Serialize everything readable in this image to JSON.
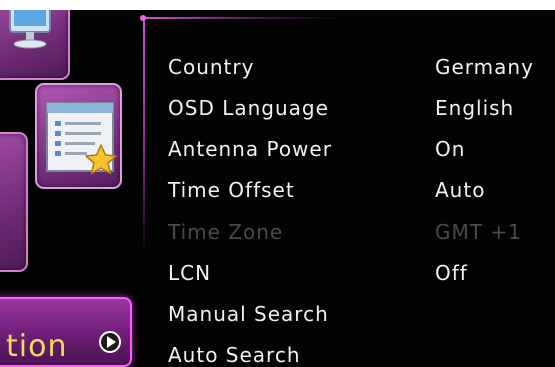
{
  "sidebar": {
    "tiles": [
      {
        "name": "monitor",
        "icon": "monitor-icon"
      },
      {
        "name": "settings",
        "icon": "settings-star-icon"
      },
      {
        "name": "side",
        "icon": ""
      }
    ],
    "active_label": "tion",
    "active_icon": "arrow-right-icon"
  },
  "menu": {
    "items": [
      {
        "label": "Country",
        "value": "Germany",
        "enabled": true
      },
      {
        "label": "OSD Language",
        "value": "English",
        "enabled": true
      },
      {
        "label": "Antenna Power",
        "value": "On",
        "enabled": true
      },
      {
        "label": "Time Offset",
        "value": "Auto",
        "enabled": true
      },
      {
        "label": "Time Zone",
        "value": "GMT +1",
        "enabled": false
      },
      {
        "label": "LCN",
        "value": "Off",
        "enabled": true
      },
      {
        "label": "Manual Search",
        "value": "",
        "enabled": true
      },
      {
        "label": "Auto Search",
        "value": "",
        "enabled": true
      }
    ]
  },
  "colors": {
    "background": "#030303",
    "text": "#f1f1f1",
    "disabled_text": "#4a4a4a",
    "accent": "#d24fd8",
    "active_label": "#f2d95a"
  }
}
